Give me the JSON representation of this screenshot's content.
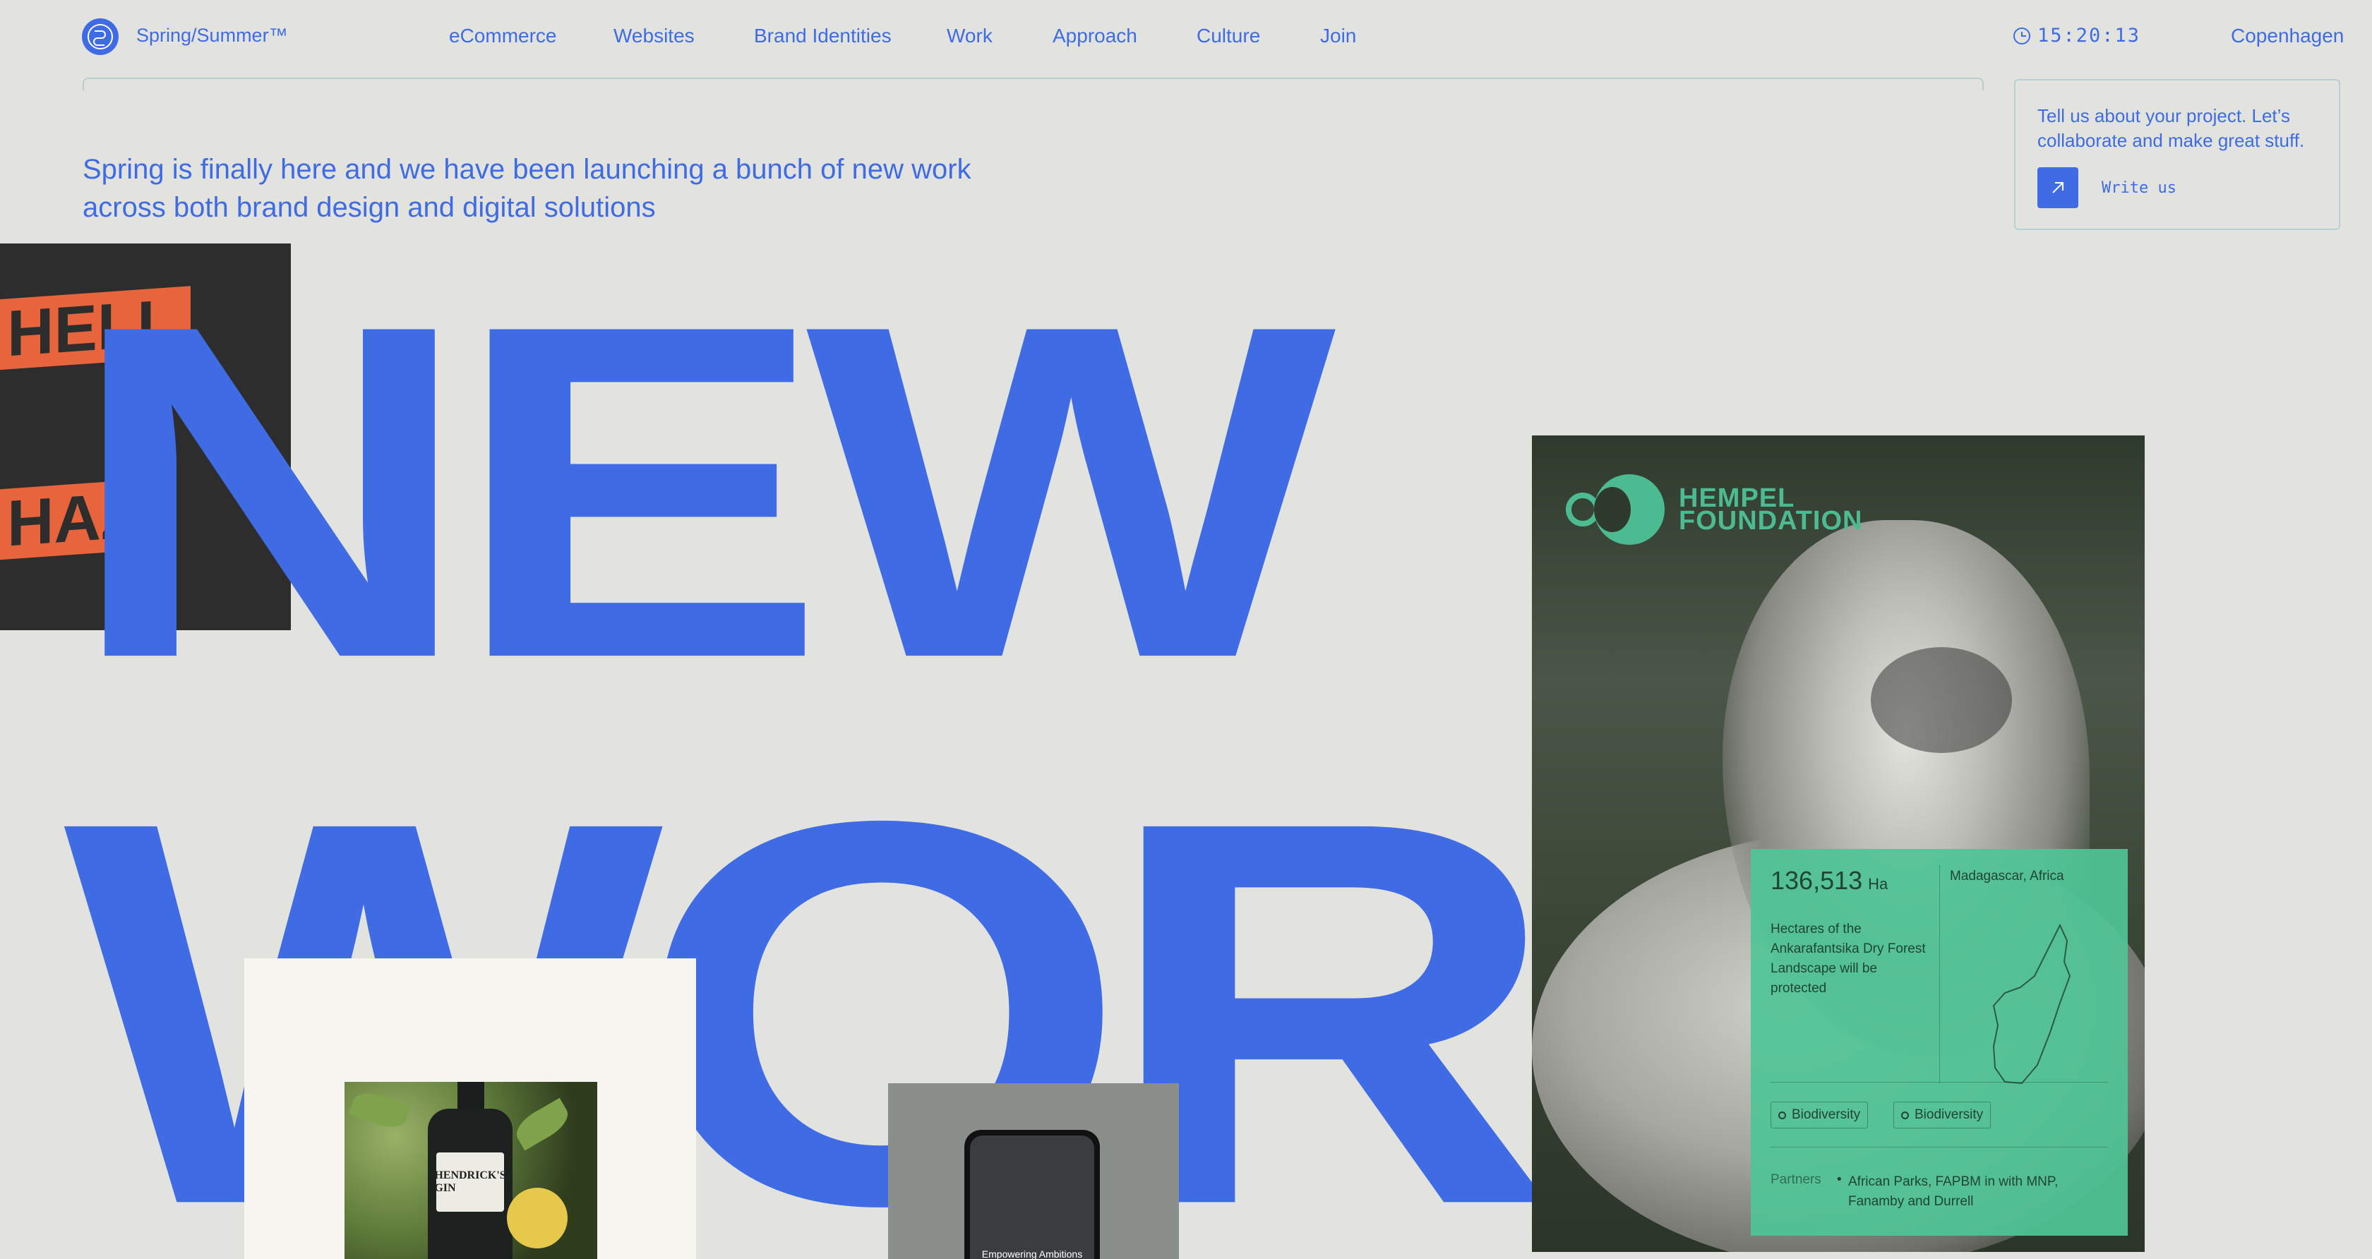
{
  "header": {
    "brand": "Spring/Summer™",
    "nav": [
      "eCommerce",
      "Websites",
      "Brand Identities",
      "Work",
      "Approach",
      "Culture",
      "Join"
    ],
    "clock": "15:20:13",
    "city": "Copenhagen"
  },
  "intro": {
    "line1": "Spring is finally here and we have been launching a bunch of new work",
    "line2": "across both brand design and digital solutions"
  },
  "contact": {
    "text": "Tell us about your project. Let’s collaborate and make great stuff.",
    "button": "Write us"
  },
  "headline": {
    "word1": "NEW",
    "word2": "WORK"
  },
  "poster": {
    "line1": "HELL",
    "line2": "HAZI"
  },
  "gin": {
    "label": "HENDRICK'S GIN"
  },
  "phone": {
    "caption": "Empowering Ambitions"
  },
  "hempel": {
    "logo_line1": "HEMPEL",
    "logo_line2": "FOUNDATION",
    "stat_value": "136,513",
    "stat_unit": "Ha",
    "stat_desc": "Hectares of the Ankarafantsika Dry Forest Landscape will be protected",
    "region": "Madagascar, Africa",
    "tags": [
      "Biodiversity",
      "Biodiversity"
    ],
    "partners_label": "Partners",
    "partners_value": "African Parks, FAPBM in with MNP, Fanamby and Durrell"
  },
  "colors": {
    "accent": "#3f6be4",
    "background": "#e2e3de",
    "hempel_green": "#4dbb92",
    "poster_orange": "#e8643c"
  }
}
